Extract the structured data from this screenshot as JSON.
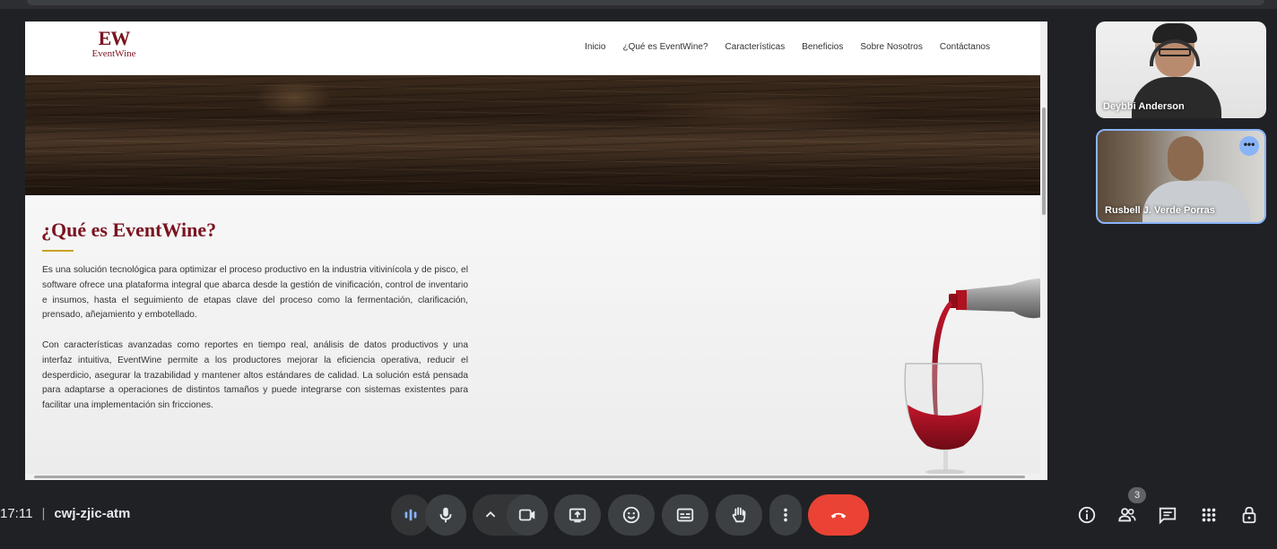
{
  "site": {
    "logo_mark": "EW",
    "logo_text": "EventWine",
    "nav": [
      "Inicio",
      "¿Qué es EventWine?",
      "Características",
      "Beneficios",
      "Sobre Nosotros",
      "Contáctanos"
    ],
    "heading": "¿Qué es EventWine?",
    "paragraph_1": "Es una solución tecnológica para optimizar el proceso productivo en la industria vitivinícola y de pisco, el software ofrece una plataforma integral que abarca desde la gestión de vinificación, control de inventario e insumos, hasta el seguimiento de etapas clave del proceso como la fermentación, clarificación, prensado, añejamiento y embotellado.",
    "paragraph_2": "Con características avanzadas como reportes en tiempo real, análisis de datos productivos y una interfaz intuitiva, EventWine permite a los productores mejorar la eficiencia operativa, reducir el desperdicio, asegurar la trazabilidad y mantener altos estándares de calidad. La solución está pensada para adaptarse a operaciones de distintos tamaños y puede integrarse con sistemas existentes para facilitar una implementación sin fricciones.",
    "brand_color": "#7a1420",
    "accent_color": "#c9a227"
  },
  "participants": [
    {
      "name": "Deybbi Anderson"
    },
    {
      "name": "Rusbell J. Verde Porras"
    }
  ],
  "meeting": {
    "time": "17:11",
    "separator": "|",
    "code": "cwj-zjic-atm",
    "people_count": "3"
  },
  "controls": {
    "icons": [
      "audio-level-icon",
      "mic-icon",
      "chevron-up-icon",
      "camera-icon",
      "present-icon",
      "emoji-icon",
      "captions-icon",
      "raise-hand-icon",
      "more-vert-icon",
      "end-call-icon"
    ],
    "right_icons": [
      "info-icon",
      "people-icon",
      "chat-icon",
      "activities-icon",
      "host-controls-icon"
    ],
    "end_color": "#ea4335"
  }
}
